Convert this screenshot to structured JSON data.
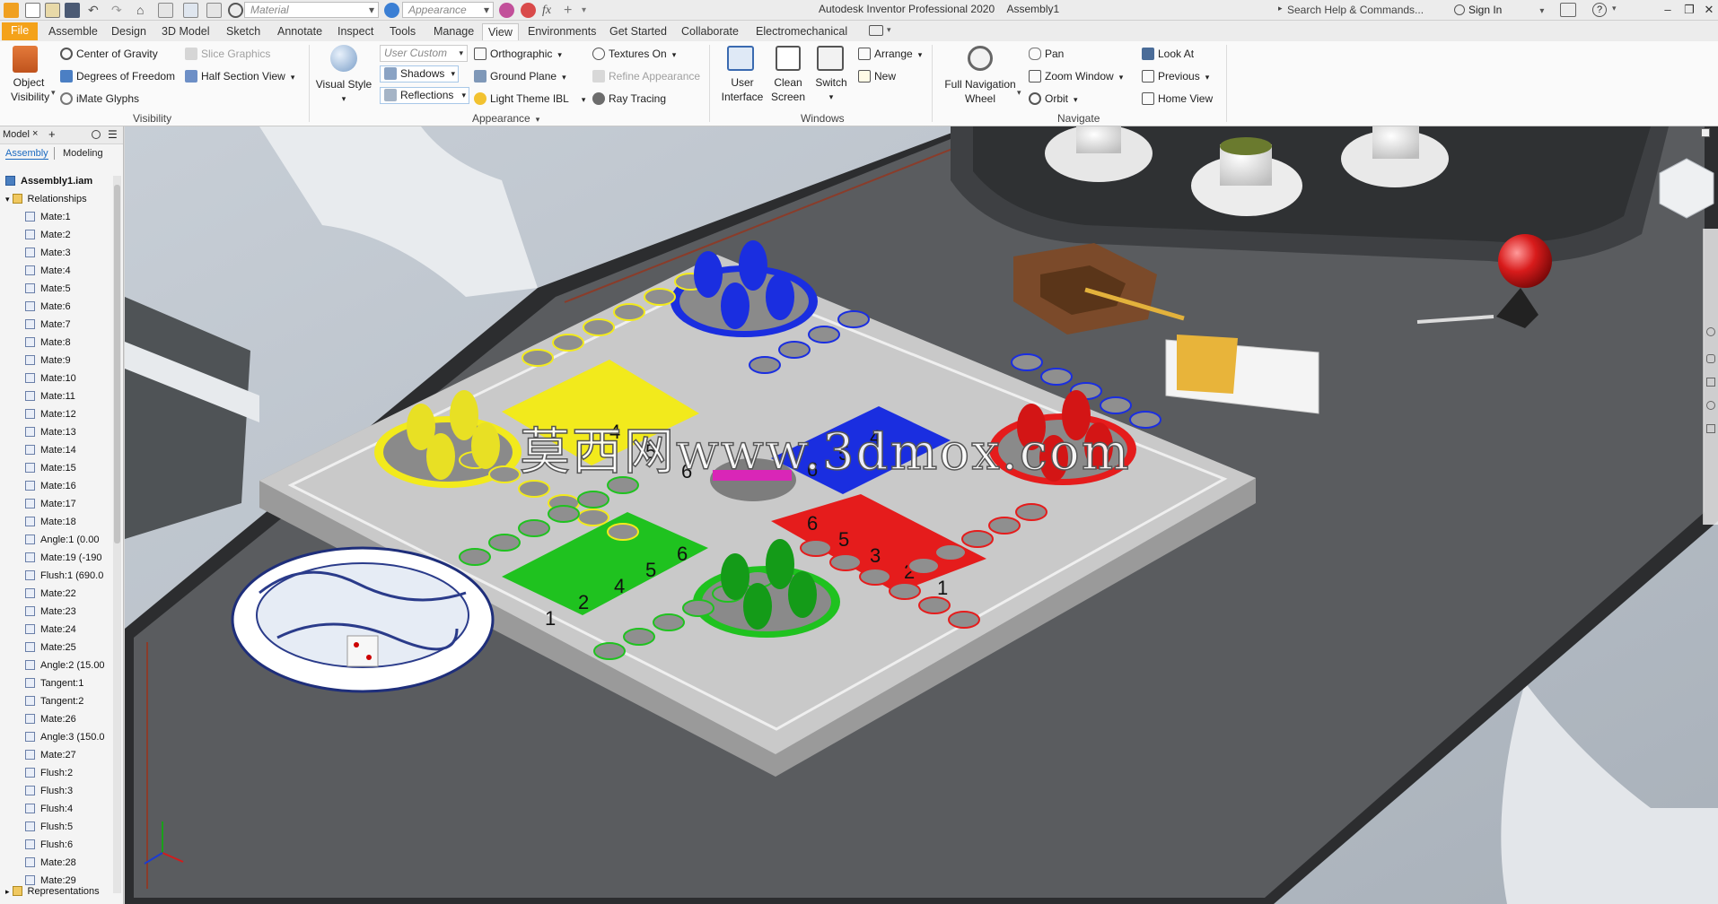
{
  "titlebar": {
    "material_placeholder": "Material",
    "appearance_placeholder": "Appearance",
    "app_title": "Autodesk Inventor Professional 2020",
    "document": "Assembly1",
    "search_placeholder": "Search Help & Commands...",
    "sign_in": "Sign In",
    "help_glyph": "?",
    "fx_glyph": "fx"
  },
  "menu": {
    "tabs": [
      "File",
      "Assemble",
      "Design",
      "3D Model",
      "Sketch",
      "Annotate",
      "Inspect",
      "Tools",
      "Manage",
      "View",
      "Environments",
      "Get Started",
      "Collaborate",
      "Electromechanical"
    ],
    "active_tab": "View"
  },
  "ribbon": {
    "visibility": {
      "object_visibility_line1": "Object",
      "object_visibility_line2": "Visibility",
      "center_of_gravity": "Center of Gravity",
      "degrees_of_freedom": "Degrees of Freedom",
      "imate_glyphs": "iMate Glyphs",
      "slice_graphics": "Slice Graphics",
      "half_section_view": "Half Section View",
      "label": "Visibility"
    },
    "appearance": {
      "visual_style": "Visual Style",
      "user_custom": "User Custom",
      "shadows": "Shadows",
      "reflections": "Reflections",
      "orthographic": "Orthographic",
      "ground_plane": "Ground Plane",
      "light_theme": "Light Theme IBL",
      "textures_on": "Textures On",
      "refine_appearance": "Refine Appearance",
      "ray_tracing": "Ray Tracing",
      "label": "Appearance"
    },
    "windows": {
      "user_interface_line1": "User",
      "user_interface_line2": "Interface",
      "clean_screen_line1": "Clean",
      "clean_screen_line2": "Screen",
      "switch": "Switch",
      "arrange": "Arrange",
      "new": "New",
      "label": "Windows"
    },
    "navigate": {
      "full_nav_line1": "Full Navigation",
      "full_nav_line2": "Wheel",
      "pan": "Pan",
      "zoom_window": "Zoom Window",
      "orbit": "Orbit",
      "look_at": "Look At",
      "previous": "Previous",
      "home_view": "Home View",
      "label": "Navigate"
    }
  },
  "browser": {
    "title": "Model",
    "close_glyph": "×",
    "add_glyph": "+",
    "tab_assembly": "Assembly",
    "tab_modeling": "Modeling",
    "root": "Assembly1.iam",
    "relationships": "Relationships",
    "items": [
      "Mate:1",
      "Mate:2",
      "Mate:3",
      "Mate:4",
      "Mate:5",
      "Mate:6",
      "Mate:7",
      "Mate:8",
      "Mate:9",
      "Mate:10",
      "Mate:11",
      "Mate:12",
      "Mate:13",
      "Mate:14",
      "Mate:15",
      "Mate:16",
      "Mate:17",
      "Mate:18",
      "Angle:1 (0.00",
      "Mate:19 (-190",
      "Flush:1 (690.0",
      "Mate:22",
      "Mate:23",
      "Mate:24",
      "Mate:25",
      "Angle:2 (15.00",
      "Tangent:1",
      "Tangent:2",
      "Mate:26",
      "Angle:3 (150.0",
      "Mate:27",
      "Flush:2",
      "Flush:3",
      "Flush:4",
      "Flush:5",
      "Flush:6",
      "Mate:28",
      "Mate:29"
    ],
    "representations": "Representations"
  },
  "viewport": {
    "watermark": "莫西网www.3dmox.com",
    "board_numbers": [
      "1",
      "2",
      "3",
      "4",
      "5",
      "6"
    ],
    "colors": {
      "yellow": "#f2ea1c",
      "blue": "#1a2ee0",
      "red": "#e51c1c",
      "green": "#1fc21f",
      "board": "#c9c9c9",
      "table": "#5a5c5f"
    }
  }
}
